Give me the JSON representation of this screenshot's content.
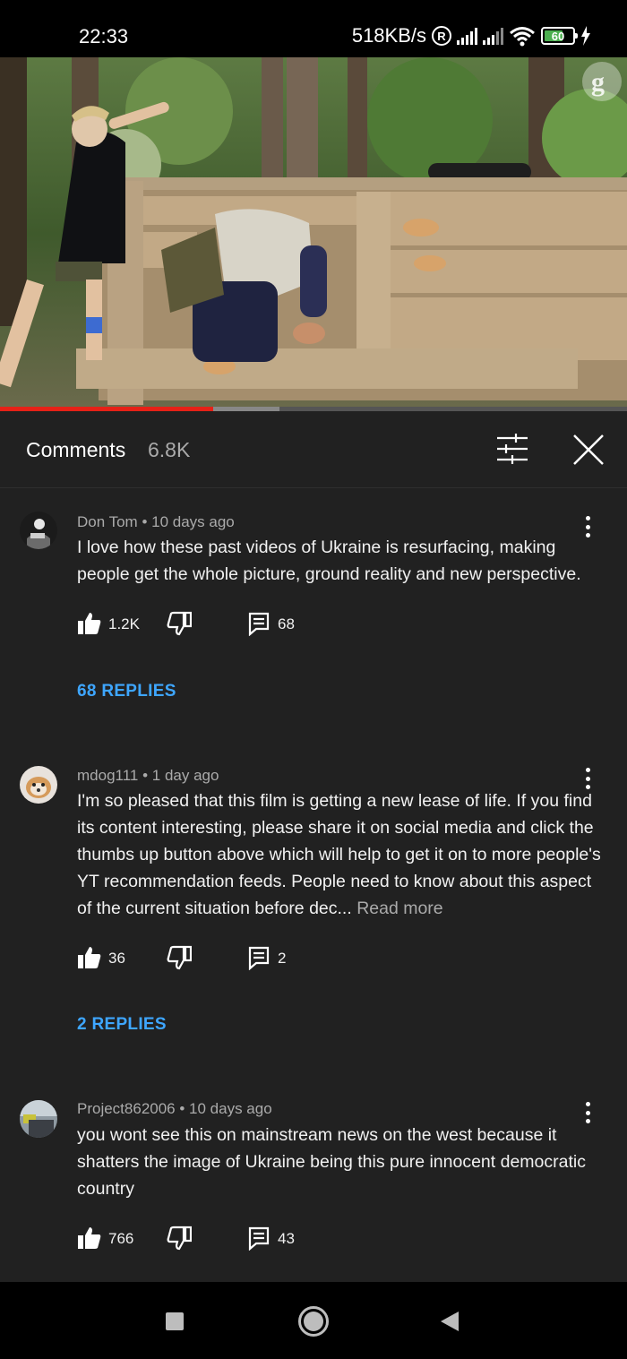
{
  "status_bar": {
    "time": "22:33",
    "net_speed": "518KB/s",
    "registered_mark": "R",
    "battery_level": "60",
    "icons": [
      "signal-icon",
      "signal-icon",
      "wifi-icon",
      "battery-icon",
      "charging-icon"
    ]
  },
  "video": {
    "progress_fraction": 0.34,
    "watermark_icon": "guardian-logo-icon"
  },
  "comments_panel": {
    "title": "Comments",
    "count": "6.8K",
    "sort_icon": "sort-filter-icon",
    "close_icon": "close-icon"
  },
  "comments": [
    {
      "author": "Don Tom",
      "time": "10 days ago",
      "meta": "Don Tom • 10 days ago",
      "text": "I love how these past videos of Ukraine is resurfacing, making people get the whole picture, ground reality and new perspective.",
      "read_more": "",
      "likes": "1.2K",
      "reply_count": "68",
      "replies_label": "68 REPLIES"
    },
    {
      "author": "mdog111",
      "time": "1 day ago",
      "meta": "mdog111 • 1 day ago",
      "text": "I'm so pleased that this film is getting a new lease of life. If you find its content interesting, please share it on social media and click the thumbs up button above which will help to get it on to more people's YT recommendation feeds.  People need to know about this aspect of the current situation before dec...",
      "read_more": "Read more",
      "likes": "36",
      "reply_count": "2",
      "replies_label": "2 REPLIES"
    },
    {
      "author": "Project862006",
      "time": "10 days ago",
      "meta": "Project862006 • 10 days ago",
      "text": "you wont see this on mainstream news on the west because it shatters the image of Ukraine being this pure innocent democratic country",
      "read_more": "",
      "likes": "766",
      "reply_count": "43",
      "replies_label": ""
    }
  ],
  "nav_bar": {
    "icons": [
      "recent-apps-icon",
      "home-icon",
      "back-icon"
    ]
  },
  "colors": {
    "background": "#212121",
    "accent_link": "#3ea6ff",
    "progress": "#e62117"
  }
}
